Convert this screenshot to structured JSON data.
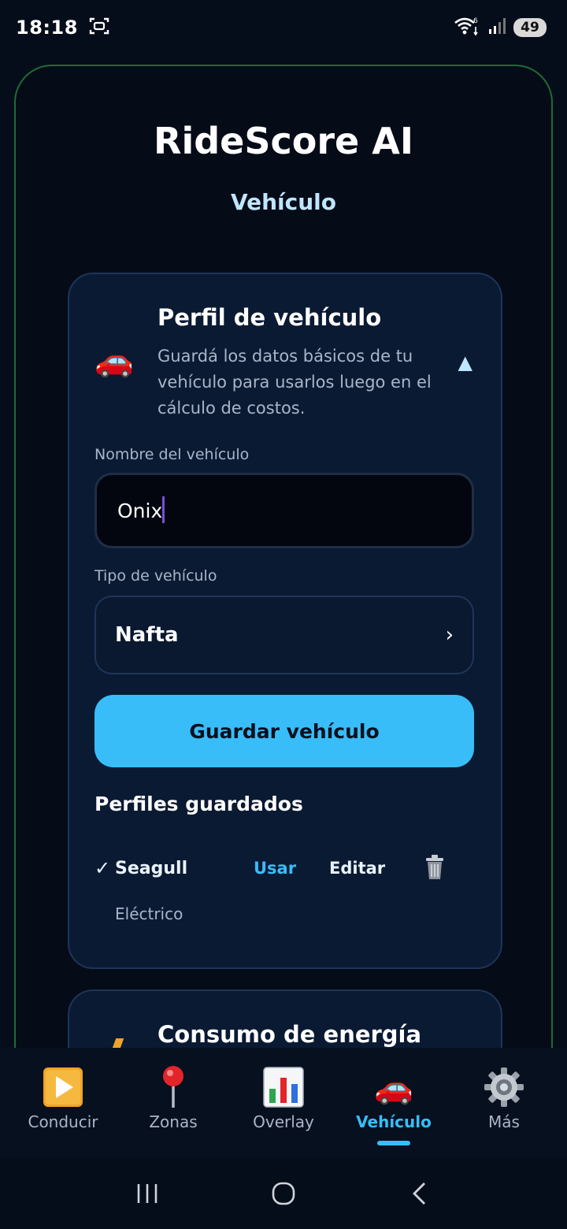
{
  "status_bar": {
    "time": "18:18",
    "battery": "49"
  },
  "app": {
    "title": "RideScore AI",
    "subtitle": "Vehículo"
  },
  "vehicle_card": {
    "title": "Perfil de vehículo",
    "icon": "car-icon",
    "description": "Guardá los datos básicos de tu vehículo para usarlos luego en el cálculo de costos.",
    "toggle": "▲",
    "name_label": "Nombre del vehículo",
    "name_value": "Onix",
    "type_label": "Tipo de vehículo",
    "type_value": "Nafta",
    "type_chevron": "›",
    "save_label": "Guardar vehículo",
    "saved_title": "Perfiles guardados",
    "profiles": [
      {
        "check": "✓",
        "name": "Seagull",
        "type": "Eléctrico",
        "use": "Usar",
        "edit": "Editar"
      }
    ]
  },
  "energy_card": {
    "title": "Consumo de energía"
  },
  "bottom_nav": {
    "items": [
      {
        "label": "Conducir",
        "icon": "play-icon"
      },
      {
        "label": "Zonas",
        "icon": "pin-icon"
      },
      {
        "label": "Overlay",
        "icon": "chart-icon"
      },
      {
        "label": "Vehículo",
        "icon": "car-icon",
        "active": true
      },
      {
        "label": "Más",
        "icon": "gear-icon"
      }
    ]
  },
  "colors": {
    "accent": "#38bdf8",
    "card": "#0b1a33",
    "background": "#050b17"
  }
}
